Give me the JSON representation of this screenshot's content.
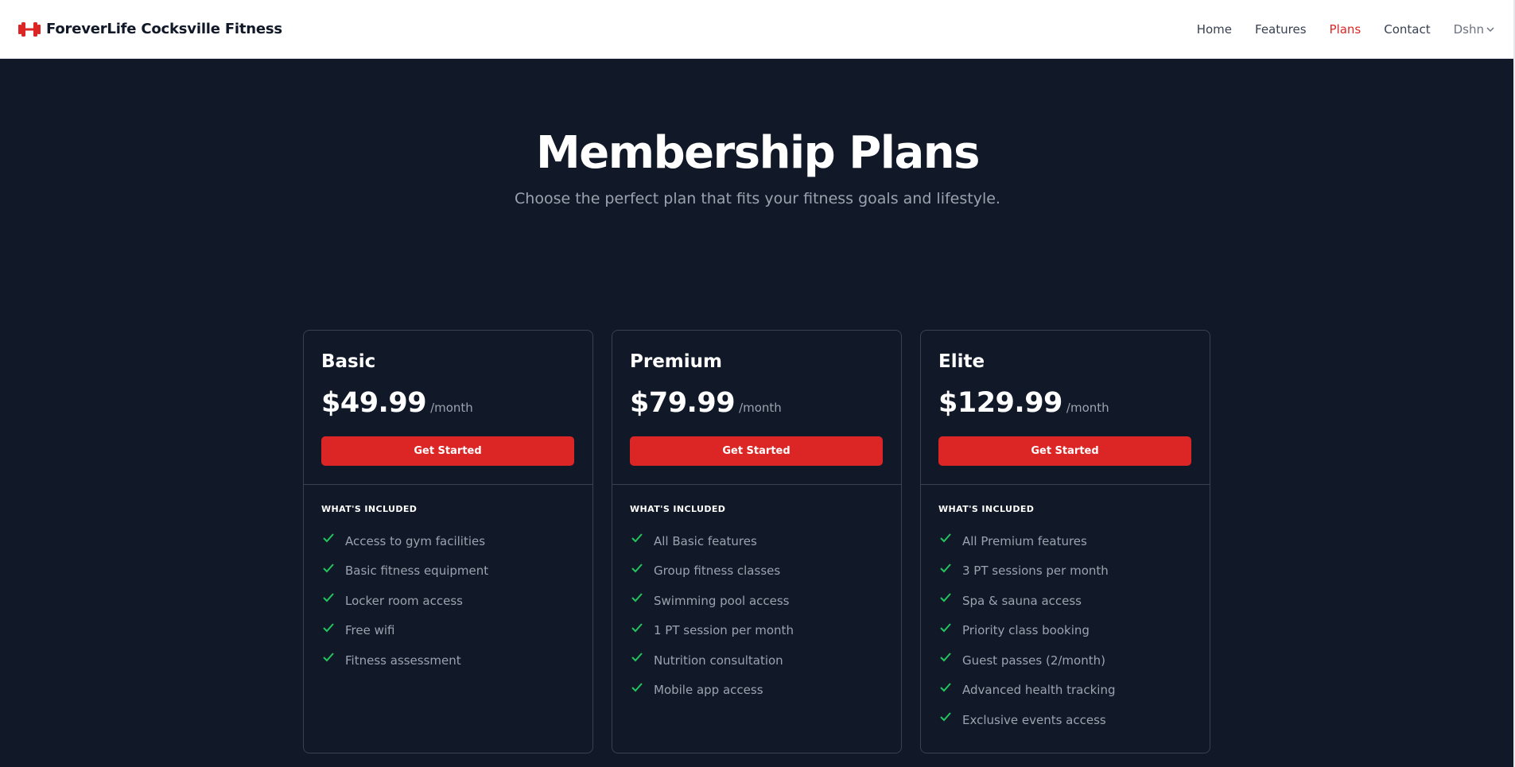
{
  "nav": {
    "brand": "ForeverLife Cocksville Fitness",
    "brand_icon": "dumbbell-icon",
    "links": [
      "Home",
      "Features",
      "Plans",
      "Contact"
    ],
    "active_link": "Plans",
    "user": "Dshn"
  },
  "hero": {
    "title": "Membership Plans",
    "subtitle": "Choose the perfect plan that fits your fitness goals and lifestyle."
  },
  "colors": {
    "accent": "#dc2626",
    "background": "#111827",
    "check": "#22c55e"
  },
  "plans": [
    {
      "name": "Basic",
      "price": "$49.99",
      "period": "/month",
      "cta": "Get Started",
      "included_title": "WHAT'S INCLUDED",
      "features": [
        "Access to gym facilities",
        "Basic fitness equipment",
        "Locker room access",
        "Free wifi",
        "Fitness assessment"
      ]
    },
    {
      "name": "Premium",
      "price": "$79.99",
      "period": "/month",
      "cta": "Get Started",
      "included_title": "WHAT'S INCLUDED",
      "features": [
        "All Basic features",
        "Group fitness classes",
        "Swimming pool access",
        "1 PT session per month",
        "Nutrition consultation",
        "Mobile app access"
      ]
    },
    {
      "name": "Elite",
      "price": "$129.99",
      "period": "/month",
      "cta": "Get Started",
      "included_title": "WHAT'S INCLUDED",
      "features": [
        "All Premium features",
        "3 PT sessions per month",
        "Spa & sauna access",
        "Priority class booking",
        "Guest passes (2/month)",
        "Advanced health tracking",
        "Exclusive events access"
      ]
    }
  ]
}
